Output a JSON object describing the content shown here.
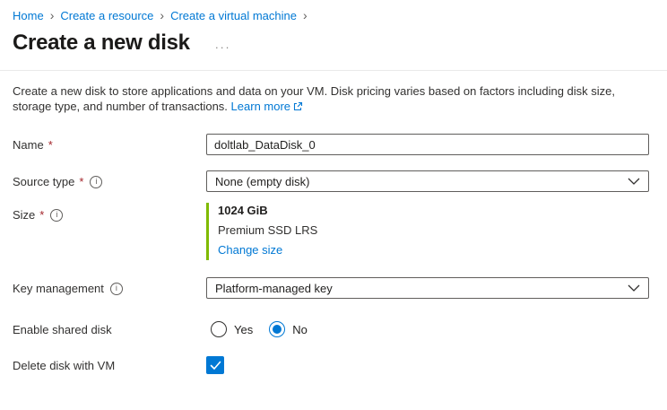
{
  "breadcrumb": {
    "separator": "›",
    "items": [
      {
        "label": "Home"
      },
      {
        "label": "Create a resource"
      },
      {
        "label": "Create a virtual machine"
      }
    ]
  },
  "header": {
    "title": "Create a new disk",
    "more_glyph": "···"
  },
  "description": {
    "text": "Create a new disk to store applications and data on your VM. Disk pricing varies based on factors including disk size, storage type, and number of transactions.",
    "link_label": "Learn more"
  },
  "form": {
    "required_marker": "*",
    "name": {
      "label": "Name",
      "value": "doltlab_DataDisk_0"
    },
    "source_type": {
      "label": "Source type",
      "value": "None (empty disk)"
    },
    "size": {
      "label": "Size",
      "value": "1024 GiB",
      "sku": "Premium SSD LRS",
      "change_link": "Change size"
    },
    "key_management": {
      "label": "Key management",
      "value": "Platform-managed key"
    },
    "enable_shared_disk": {
      "label": "Enable shared disk",
      "options": [
        {
          "label": "Yes",
          "selected": false
        },
        {
          "label": "No",
          "selected": true
        }
      ]
    },
    "delete_with_vm": {
      "label": "Delete disk with VM",
      "checked": true
    }
  },
  "icons": {
    "info": "i"
  },
  "colors": {
    "accent": "#0078d4",
    "required_asterisk": "#a4262c",
    "size_accent_bar": "#7fba00",
    "title_text": "#1b1a19"
  }
}
